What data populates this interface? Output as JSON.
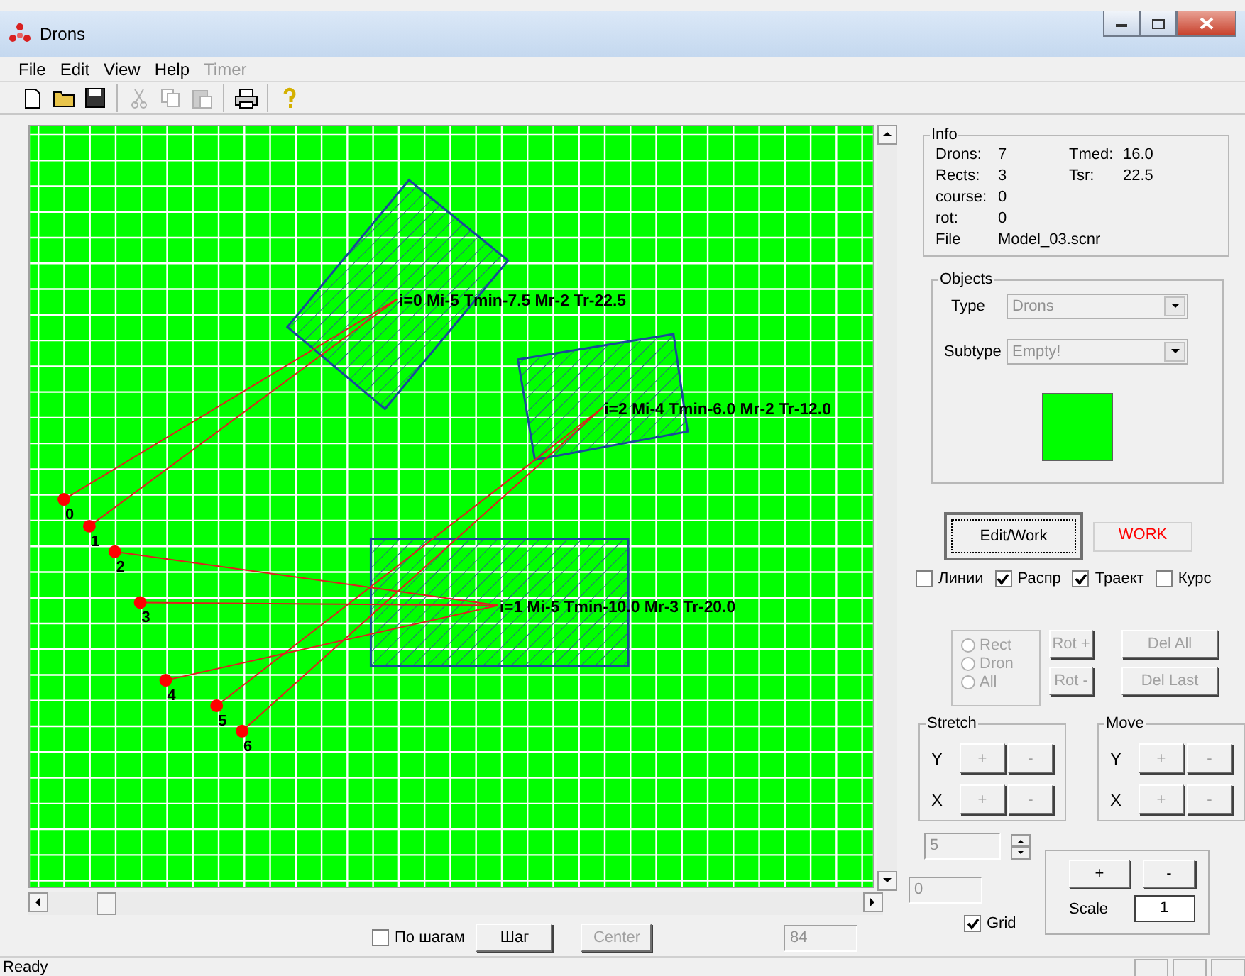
{
  "window": {
    "title": "Drons"
  },
  "menu": [
    {
      "label": "File",
      "disabled": false
    },
    {
      "label": "Edit",
      "disabled": false
    },
    {
      "label": "View",
      "disabled": false
    },
    {
      "label": "Help",
      "disabled": false
    },
    {
      "label": "Timer",
      "disabled": true
    }
  ],
  "toolbar": [
    {
      "kind": "new",
      "disabled": false
    },
    {
      "kind": "open",
      "disabled": false
    },
    {
      "kind": "save",
      "disabled": false
    },
    {
      "kind": "sep"
    },
    {
      "kind": "cut",
      "disabled": true
    },
    {
      "kind": "copy",
      "disabled": true
    },
    {
      "kind": "paste",
      "disabled": true
    },
    {
      "kind": "sep"
    },
    {
      "kind": "print",
      "disabled": false
    },
    {
      "kind": "sep"
    },
    {
      "kind": "help",
      "disabled": false
    }
  ],
  "canvas": {
    "drones": [
      {
        "label": "0"
      },
      {
        "label": "1"
      },
      {
        "label": "2"
      },
      {
        "label": "3"
      },
      {
        "label": "4"
      },
      {
        "label": "5"
      },
      {
        "label": "6"
      }
    ],
    "zones": [
      {
        "label": "i=0 Mi-5 Tmin-7.5 Mr-2 Tr-22.5"
      },
      {
        "label": "i=1 Mi-5 Tmin-10.0 Mr-3 Tr-20.0"
      },
      {
        "label": "i=2 Mi-4 Tmin-6.0 Mr-2 Tr-12.0"
      }
    ]
  },
  "bottom": {
    "step_mode": {
      "label": "По шагам",
      "checked": false
    },
    "step_button": {
      "label": "Шаг",
      "disabled": false
    },
    "center_button": {
      "label": "Center",
      "disabled": true
    },
    "value_field": {
      "value": "84",
      "disabled": true
    }
  },
  "info": {
    "title": "Info",
    "rows": [
      {
        "label": "Drons:",
        "value": "7",
        "label2": "Tmed:",
        "value2": "16.0"
      },
      {
        "label": "Rects:",
        "value": "3",
        "label2": "Tsr:",
        "value2": "22.5"
      },
      {
        "label": "course:",
        "value": "0"
      },
      {
        "label": "rot:",
        "value": "0"
      },
      {
        "label": "File",
        "value": "Model_03.scnr"
      }
    ]
  },
  "objects": {
    "title": "Objects",
    "fields": [
      {
        "label": "Type",
        "value": "Drons",
        "disabled": true
      },
      {
        "label": "Subtype",
        "value": "Empty!",
        "disabled": true
      }
    ],
    "color": "#00ff00"
  },
  "mode_button": {
    "label": "Edit/Work"
  },
  "mode_display": {
    "value": "WORK"
  },
  "options": [
    {
      "label": "Линии",
      "checked": false
    },
    {
      "label": "Распр",
      "checked": true
    },
    {
      "label": "Траект",
      "checked": true
    },
    {
      "label": "Курс",
      "checked": false
    }
  ],
  "select_group": {
    "options": [
      {
        "label": "Rect",
        "selected": false,
        "disabled": true
      },
      {
        "label": "Dron",
        "selected": false,
        "disabled": true
      },
      {
        "label": "All",
        "selected": false,
        "disabled": true
      }
    ]
  },
  "rot_buttons": [
    {
      "label": "Rot +",
      "disabled": true
    },
    {
      "label": "Rot -",
      "disabled": true
    }
  ],
  "del_buttons": [
    {
      "label": "Del All",
      "disabled": true
    },
    {
      "label": "Del Last",
      "disabled": true
    }
  ],
  "stretch": {
    "title": "Stretch",
    "rows": [
      {
        "axis": "Y",
        "buttons": [
          {
            "label": "+",
            "disabled": true
          },
          {
            "label": "-",
            "disabled": true
          }
        ]
      },
      {
        "axis": "X",
        "buttons": [
          {
            "label": "+",
            "disabled": true
          },
          {
            "label": "-",
            "disabled": true
          }
        ]
      }
    ]
  },
  "move": {
    "title": "Move",
    "rows": [
      {
        "axis": "Y",
        "buttons": [
          {
            "label": "+",
            "disabled": true
          },
          {
            "label": "-",
            "disabled": true
          }
        ]
      },
      {
        "axis": "X",
        "buttons": [
          {
            "label": "+",
            "disabled": true
          },
          {
            "label": "-",
            "disabled": true
          }
        ]
      }
    ]
  },
  "step_field": {
    "value": "5",
    "disabled": true
  },
  "offset_field": {
    "value": "0",
    "disabled": true
  },
  "grid": {
    "label": "Grid",
    "checked": true
  },
  "scale": {
    "buttons": [
      {
        "label": "+",
        "disabled": false
      },
      {
        "label": "-",
        "disabled": false
      }
    ],
    "label": "Scale",
    "value": "1"
  },
  "status": {
    "text": "Ready"
  }
}
